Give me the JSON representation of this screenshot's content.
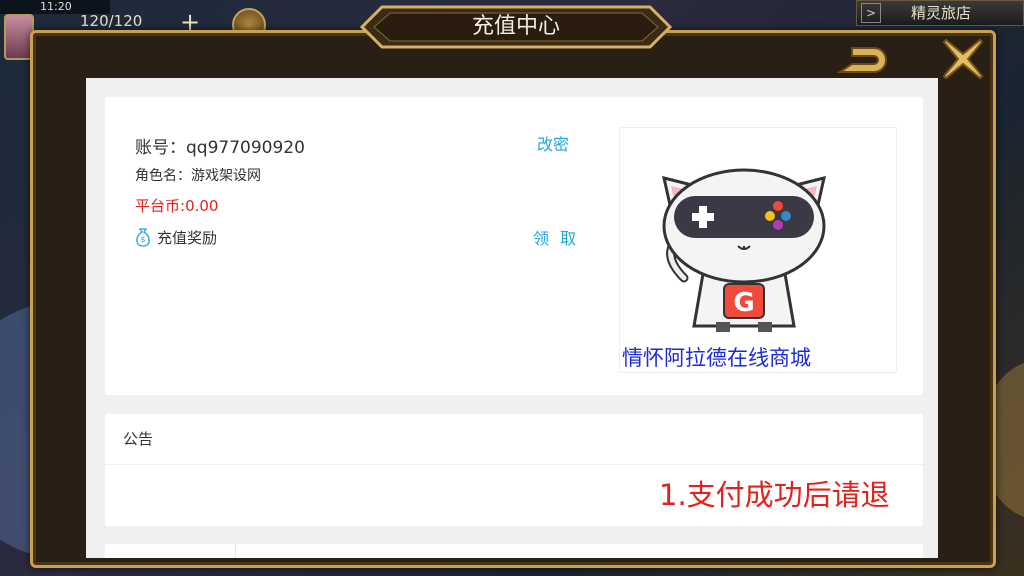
{
  "statusbar": {
    "time": "11:20"
  },
  "hud": {
    "stamina": "120/120",
    "plus": "+",
    "inn_arrow": ">",
    "inn_label": "精灵旅店"
  },
  "dialog": {
    "title": "充值中心"
  },
  "account": {
    "account_label": "账号：",
    "account_value": "qq977090920",
    "change_password": "改密",
    "role_label": "角色名：",
    "role_value": "游戏架设网",
    "coin_label": "平台币:",
    "coin_value": "0.00",
    "reward_label": "充值奖励",
    "claim": "领 取"
  },
  "ad": {
    "badge_letter": "G",
    "caption": "情怀阿拉德在线商城"
  },
  "notice": {
    "heading": "公告",
    "marquee": "1.支付成功后请退"
  },
  "colors": {
    "accent_link": "#1fa8d8",
    "coin_red": "#e3221c",
    "ad_blue": "#1d2bd6",
    "frame_gold": "#c9a14e"
  },
  "icons": [
    "back-arrow-icon",
    "close-x-icon",
    "money-bag-icon",
    "gamepad-cat-icon"
  ]
}
